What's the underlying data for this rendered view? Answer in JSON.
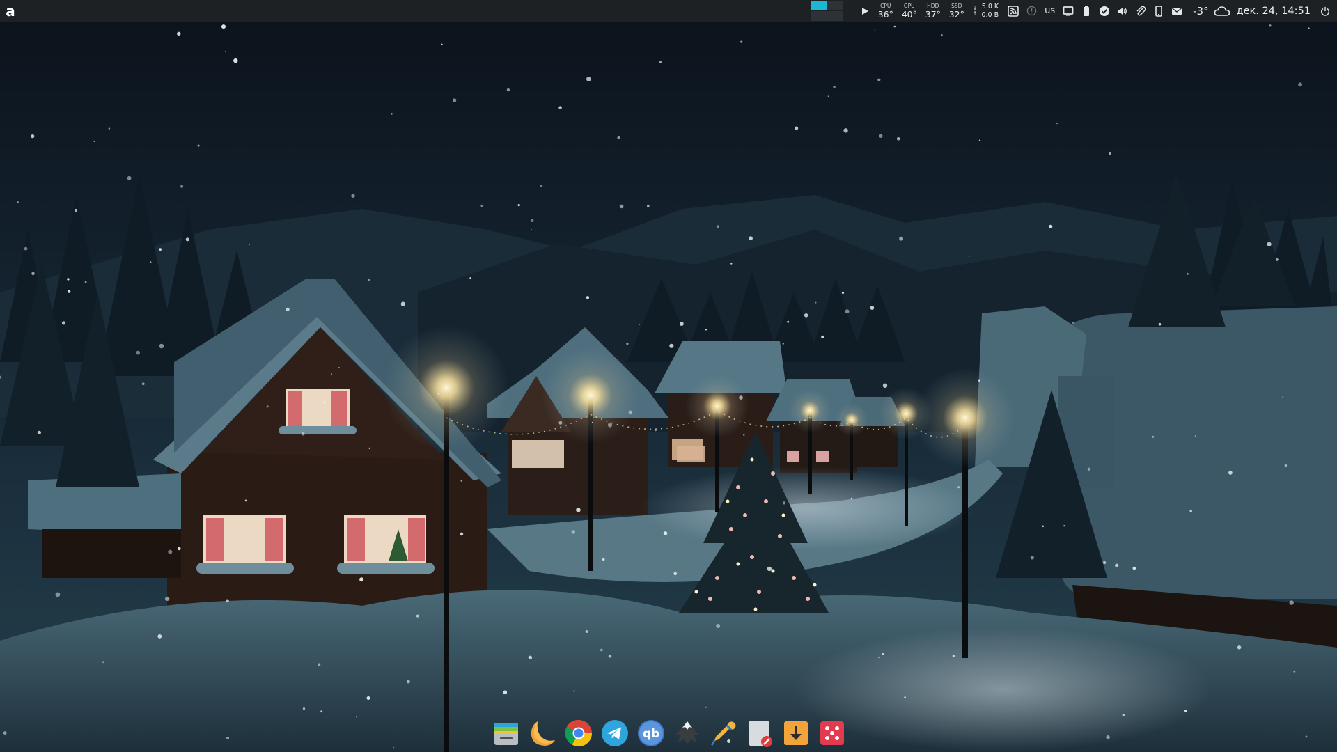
{
  "panel": {
    "launcher_label": "a",
    "pager": {
      "desktops": 4,
      "active": 1
    },
    "sensors": [
      {
        "label": "CPU",
        "value": "36°"
      },
      {
        "label": "GPU",
        "value": "40°"
      },
      {
        "label": "HDD",
        "value": "37°"
      },
      {
        "label": "SSD",
        "value": "32°"
      }
    ],
    "network": {
      "down_arrow": "↓",
      "up_arrow": "↑",
      "down": "5.0 K",
      "up": "0.0 B"
    },
    "keyboard_layout": "us",
    "weather_temp": "-3°",
    "clock": "дек. 24, 14:51",
    "accent_color": "#1ab8d4",
    "panel_color": "#1d2124"
  },
  "tray_icons": [
    "play-icon",
    "rss-icon",
    "alert-icon",
    "screen-icon",
    "battery-icon",
    "check-circle-icon",
    "volume-icon",
    "paperclip-icon",
    "phone-icon",
    "mail-icon",
    "cloud-icon",
    "power-icon"
  ],
  "dock": {
    "items": [
      {
        "name": "file-manager",
        "icon": "folder-icon"
      },
      {
        "name": "night-light",
        "icon": "moon-icon"
      },
      {
        "name": "chrome",
        "icon": "chrome-icon"
      },
      {
        "name": "telegram",
        "icon": "telegram-icon"
      },
      {
        "name": "qbittorrent",
        "icon": "qbittorrent-icon"
      },
      {
        "name": "inkscape",
        "icon": "inkscape-icon"
      },
      {
        "name": "color-picker",
        "icon": "eyedropper-icon"
      },
      {
        "name": "text-editor",
        "icon": "document-edit-icon"
      },
      {
        "name": "downloader",
        "icon": "download-icon"
      },
      {
        "name": "dice-app",
        "icon": "dice-icon"
      }
    ]
  },
  "wallpaper": {
    "subject": "snowy-night-village",
    "sky_color": "#0f1a26",
    "snow_color": "#6d8a98"
  }
}
